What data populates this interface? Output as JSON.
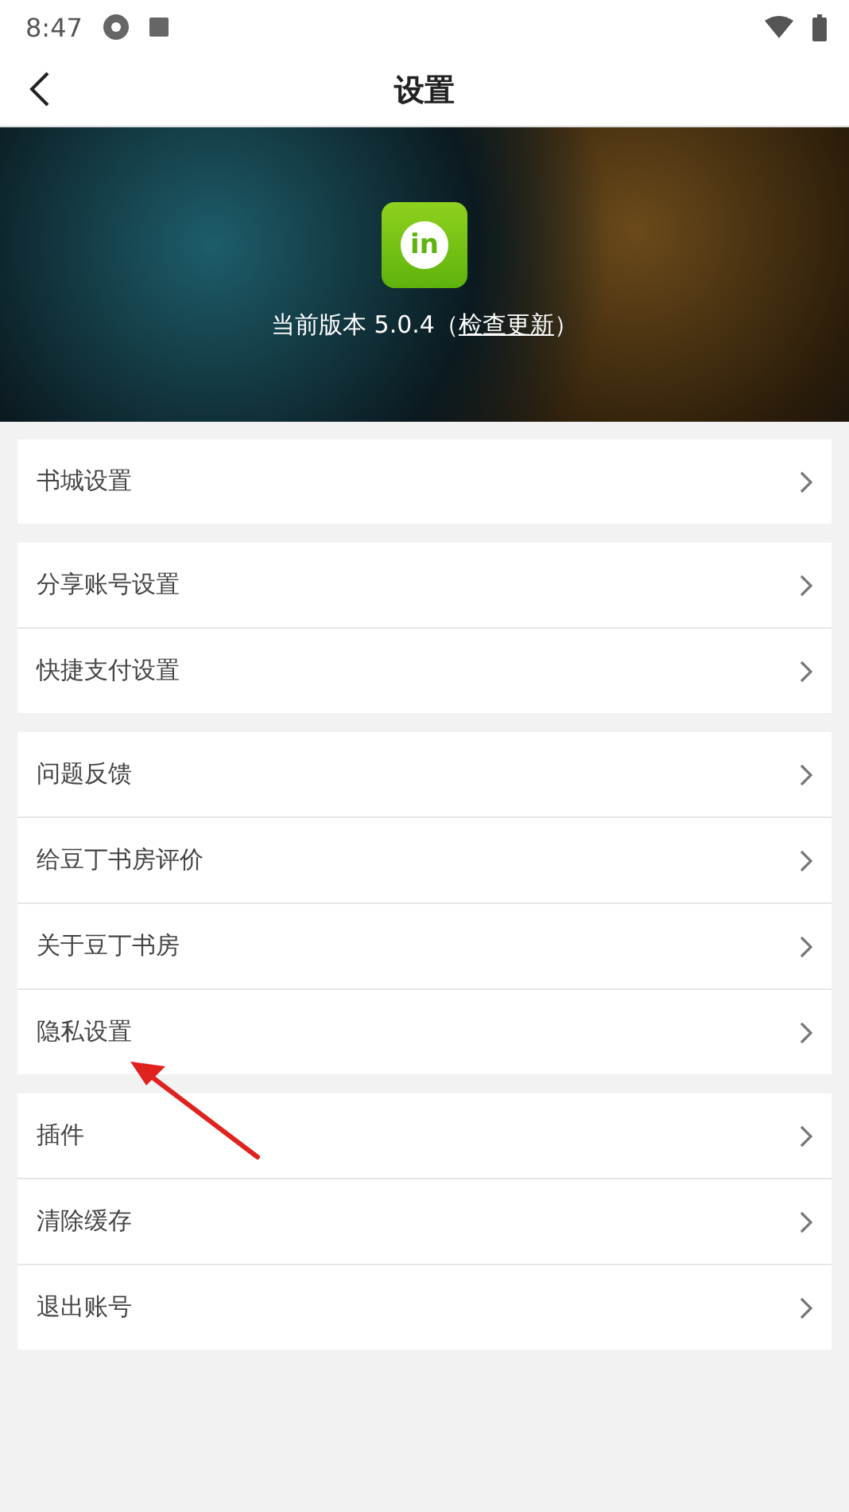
{
  "status_bar": {
    "time": "8:47"
  },
  "header": {
    "title": "设置"
  },
  "banner": {
    "logo_text": "in",
    "version_text": "当前版本 5.0.4（",
    "check_link": "检查更新",
    "version_suffix": "）"
  },
  "groups": [
    {
      "items": [
        {
          "label": "书城设置"
        }
      ]
    },
    {
      "items": [
        {
          "label": "分享账号设置"
        },
        {
          "label": "快捷支付设置"
        }
      ]
    },
    {
      "items": [
        {
          "label": "问题反馈"
        },
        {
          "label": "给豆丁书房评价"
        },
        {
          "label": "关于豆丁书房"
        },
        {
          "label": "隐私设置"
        }
      ]
    },
    {
      "items": [
        {
          "label": "插件"
        },
        {
          "label": "清除缓存"
        },
        {
          "label": "退出账号"
        }
      ]
    }
  ]
}
